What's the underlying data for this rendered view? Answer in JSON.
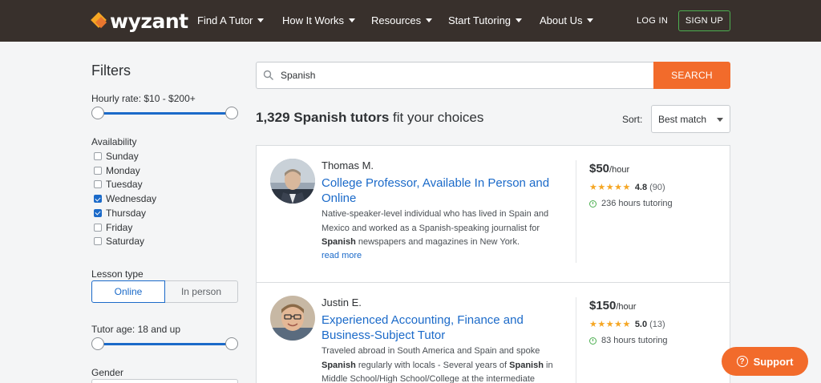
{
  "nav": {
    "logo": "wyzant",
    "items": [
      {
        "label": "Find A Tutor"
      },
      {
        "label": "How It Works"
      },
      {
        "label": "Resources"
      },
      {
        "label": "Start Tutoring"
      },
      {
        "label": "About Us"
      }
    ],
    "login": "LOG IN",
    "signup": "SIGN UP"
  },
  "filters": {
    "title": "Filters",
    "hourly_rate_label": "Hourly rate:",
    "hourly_rate_value": "$10 - $200+",
    "availability_label": "Availability",
    "days": [
      {
        "label": "Sunday",
        "checked": false
      },
      {
        "label": "Monday",
        "checked": false
      },
      {
        "label": "Tuesday",
        "checked": false
      },
      {
        "label": "Wednesday",
        "checked": true
      },
      {
        "label": "Thursday",
        "checked": true
      },
      {
        "label": "Friday",
        "checked": false
      },
      {
        "label": "Saturday",
        "checked": false
      }
    ],
    "lesson_type_label": "Lesson type",
    "lesson_online": "Online",
    "lesson_in_person": "In person",
    "lesson_selected": "Online",
    "tutor_age_label": "Tutor age:",
    "tutor_age_value": "18 and up",
    "gender_label": "Gender"
  },
  "search": {
    "value": "Spanish",
    "button": "SEARCH"
  },
  "results": {
    "count_bold": "1,329 Spanish tutors",
    "count_rest": " fit your choices",
    "sort_label": "Sort:",
    "sort_value": "Best match"
  },
  "tutors": [
    {
      "name": "Thomas M.",
      "title": "College Professor, Available In Person and Online",
      "desc_1": "Native-speaker-level individual who has lived in Spain and Mexico and worked as a Spanish-speaking journalist for ",
      "desc_bold": "Spanish",
      "desc_2": " newspapers and magazines in New York.",
      "read_more": "read more",
      "price": "$50",
      "price_unit": "/hour",
      "stars": "★★★★★",
      "rating": "4.8",
      "reviews": "(90)",
      "hours": "236 hours tutoring"
    },
    {
      "name": "Justin E.",
      "title": "Experienced Accounting, Finance and Business-Subject Tutor",
      "desc_1": "Traveled abroad in South America and Spain and spoke ",
      "desc_bold": "Spanish",
      "desc_2": " regularly with locals - Several years of ",
      "desc_bold_2": "Spanish",
      "desc_3": " in Middle School/High School/College at the intermediate",
      "price": "$150",
      "price_unit": "/hour",
      "stars": "★★★★★",
      "rating": "5.0",
      "reviews": "(13)",
      "hours": "83 hours tutoring"
    }
  ],
  "support": {
    "label": "Support"
  }
}
